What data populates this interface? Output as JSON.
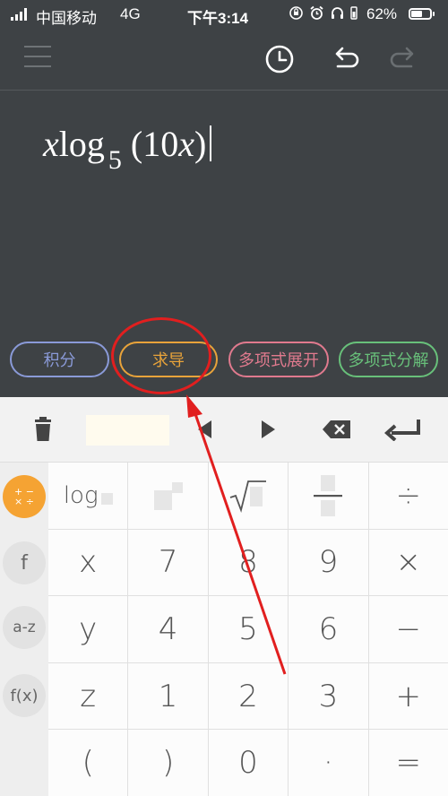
{
  "status_bar": {
    "carrier": "中国移动",
    "network": "4G",
    "time": "下午3:14",
    "battery_text": "62%",
    "battery_level": 0.62,
    "icons": [
      "signal-icon",
      "orientation-lock-icon",
      "alarm-icon",
      "headphones-icon",
      "battery-icon"
    ]
  },
  "toolbar": {
    "icons": [
      "menu-icon",
      "history-clock-icon",
      "undo-icon",
      "redo-icon"
    ]
  },
  "expression": {
    "var1": "x",
    "func": "log",
    "base": "5",
    "open_paren": "(",
    "coef": "10",
    "var2": "x",
    "close_paren": ")"
  },
  "actions": [
    {
      "label": "积分",
      "color": "#8a9ad8"
    },
    {
      "label": "求导",
      "color": "#e8a33a"
    },
    {
      "label": "多项式展开",
      "color": "#e07a8e"
    },
    {
      "label": "多项式分解",
      "color": "#68c07a"
    }
  ],
  "editbar": {
    "icons": [
      "trash-icon",
      "cursor-left-icon",
      "cursor-right-icon",
      "backspace-icon",
      "enter-icon"
    ]
  },
  "sidebar": {
    "basic_top": "+ −",
    "basic_bottom": "× ÷",
    "function": "f",
    "alpha": "a-z",
    "fx": "f(x)"
  },
  "keypad": {
    "log": "log",
    "divide": "÷",
    "row2": [
      "x",
      "7",
      "8",
      "9",
      "×"
    ],
    "row3": [
      "y",
      "4",
      "5",
      "6",
      "−"
    ],
    "row4": [
      "z",
      "1",
      "2",
      "3",
      "+"
    ],
    "row5": [
      "(",
      ")",
      "0",
      "·",
      "="
    ]
  },
  "colors": {
    "background": "#3e4245",
    "annotation": "#e11f1f",
    "active_sidebar": "#f5a333"
  }
}
